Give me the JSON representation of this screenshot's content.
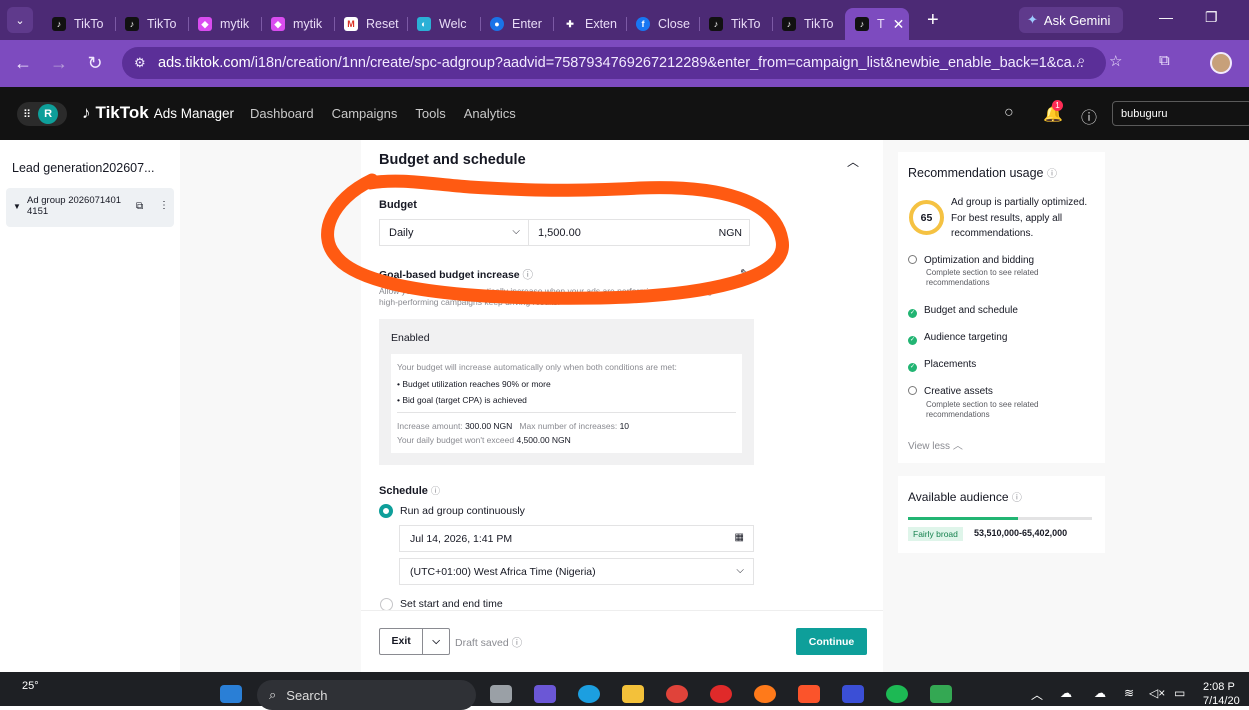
{
  "browser": {
    "tabs": [
      {
        "label": "TikTo",
        "icon": "tiktok-icon"
      },
      {
        "label": "TikTo",
        "icon": "tiktok-icon"
      },
      {
        "label": "mytik",
        "icon": "app-icon"
      },
      {
        "label": "mytik",
        "icon": "app-icon"
      },
      {
        "label": "Reset",
        "icon": "gmail-icon"
      },
      {
        "label": "Welc",
        "icon": "app-icon"
      },
      {
        "label": "Enter",
        "icon": "app-icon"
      },
      {
        "label": "Exten",
        "icon": "puzzle-icon"
      },
      {
        "label": "Close",
        "icon": "facebook-icon"
      },
      {
        "label": "TikTo",
        "icon": "tiktok-icon"
      },
      {
        "label": "TikTo",
        "icon": "tiktok-icon"
      }
    ],
    "active_tab_label": "T",
    "gemini_label": "Ask Gemini",
    "url_host": "ads.tiktok.com",
    "url_path": "/i18n/creation/1nn/create/spc-adgroup?aadvid=7587934769267212289&enter_from=campaign_list&newbie_enable_back=1&ca..."
  },
  "header": {
    "account_initial": "R",
    "logo": "TikTok",
    "logo_sub": "Ads Manager",
    "nav": [
      "Dashboard",
      "Campaigns",
      "Tools",
      "Analytics"
    ],
    "notification_count": "1",
    "account_name": "bubuguru"
  },
  "sidebar": {
    "campaign_name": "Lead generation202607...",
    "ad_group_name": "Ad group 2026071401 4151"
  },
  "budget_section": {
    "title": "Budget and schedule",
    "budget_label": "Budget",
    "budget_type": "Daily",
    "budget_amount": "1,500.00",
    "currency": "NGN",
    "goal_title": "Goal-based budget increase",
    "goal_desc": "Allow your budget to automatically increase when your ads are performing well, ensuring high-performing campaigns keep driving results.",
    "enabled_label": "Enabled",
    "conditions_intro": "Your budget will increase automatically only when both conditions are met:",
    "condition_1": "Budget utilization reaches 90% or more",
    "condition_2": "Bid goal (target CPA) is achieved",
    "increase_label": "Increase amount:",
    "increase_value": "300.00 NGN",
    "max_label": "Max number of increases:",
    "max_value": "10",
    "cap_label": "Your daily budget won't exceed",
    "cap_value": "4,500.00 NGN"
  },
  "schedule": {
    "label": "Schedule",
    "option_continuous": "Run ad group continuously",
    "start_datetime": "Jul 14, 2026, 1:41 PM",
    "timezone": "(UTC+01:00) West Africa Time (Nigeria)",
    "option_range": "Set start and end time"
  },
  "footer": {
    "exit_label": "Exit",
    "draft_label": "Draft saved",
    "continue_label": "Continue"
  },
  "recommendations": {
    "title": "Recommendation usage",
    "score": "65",
    "message": "Ad group is partially optimized. For best results, apply all recommendations.",
    "items": [
      {
        "label": "Optimization and bidding",
        "sub": "Complete section to see related recommendations",
        "done": false
      },
      {
        "label": "Budget and schedule",
        "sub": "",
        "done": true
      },
      {
        "label": "Audience targeting",
        "sub": "",
        "done": true
      },
      {
        "label": "Placements",
        "sub": "",
        "done": true
      },
      {
        "label": "Creative assets",
        "sub": "Complete section to see related recommendations",
        "done": false
      }
    ],
    "view_less": "View less"
  },
  "audience": {
    "title": "Available audience",
    "tag": "Fairly broad",
    "range": "53,510,000-65,402,000",
    "level_fraction": 0.6
  },
  "taskbar": {
    "temperature": "25°",
    "search_label": "Search",
    "time": "2:08 P",
    "date": "7/14/20"
  },
  "colors": {
    "teal": "#0e9f9a",
    "scribble": "#ff5a12",
    "browser_purple": "#7d4bbf"
  }
}
